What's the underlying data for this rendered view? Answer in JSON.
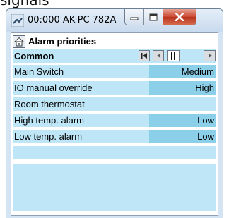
{
  "top_caption": "signals",
  "window": {
    "title": "00:000 AK-PC 782A"
  },
  "panel": {
    "header": "Alarm priorities",
    "common_label": "Common",
    "rows": [
      {
        "label": "Main Switch",
        "value": "Medium"
      },
      {
        "label": "IO manual override",
        "value": "High"
      },
      {
        "label": "Room thermostat",
        "value": ""
      },
      {
        "label": "High temp. alarm",
        "value": "Low"
      },
      {
        "label": "Low temp. alarm",
        "value": "Low"
      }
    ]
  },
  "colors": {
    "row_bg": "#bfe6f6",
    "value_bg": "#8ccfe9",
    "window_bg": "#d4e4f3"
  },
  "icons": {
    "app": "signal-icon",
    "header": "home-icon",
    "nav": [
      "first-page-icon",
      "prev-page-icon",
      "scroll-thumb",
      "next-page-icon"
    ]
  }
}
